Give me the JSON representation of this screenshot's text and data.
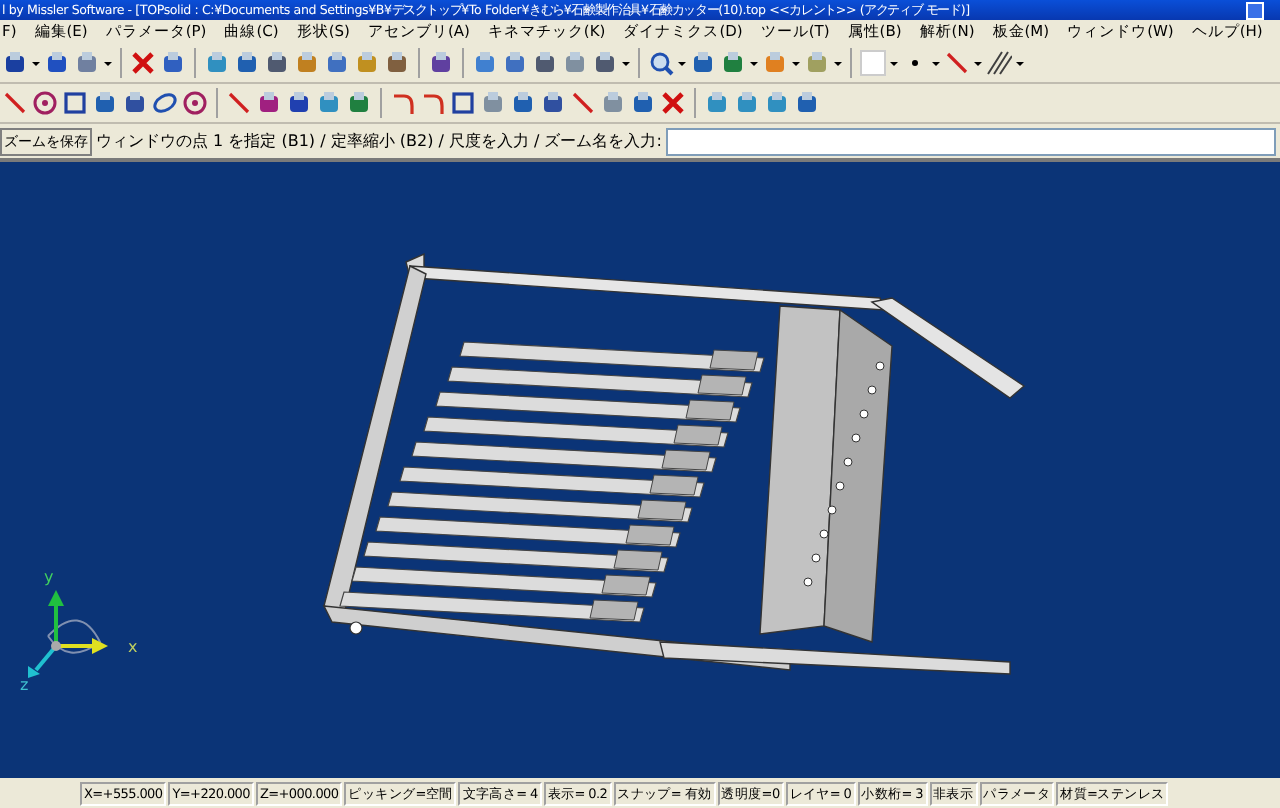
{
  "window": {
    "title": "l by Missler Software - [TOPsolid : C:¥Documents and Settings¥B¥デスクトップ¥To Folder¥きむら¥石鹸製作治具¥石鹸カッター(10).top  <<カレント>> (アクティブ モード)]"
  },
  "menu": [
    "F)",
    "編集(E)",
    "パラメータ(P)",
    "曲線(C)",
    "形状(S)",
    "アセンブリ(A)",
    "キネマチック(K)",
    "ダイナミクス(D)",
    "ツール(T)",
    "属性(B)",
    "解析(N)",
    "板金(M)",
    "ウィンドウ(W)",
    "ヘルプ(H)"
  ],
  "command_line": {
    "button": "ズームを保存",
    "prompt": "ウィンドウの点 1 を指定 (B1) / 定率縮小 (B2) / 尺度を入力 / ズーム名を入力:"
  },
  "viewport": {
    "axis_labels": [
      "y",
      "x",
      "z"
    ]
  },
  "status_bar": [
    "X=+555.000",
    "Y=+220.000",
    "Z=+000.000",
    "ピッキング=空間",
    "文字高さ= 4",
    "表示=  0.2",
    "スナップ= 有効",
    "透明度=0",
    "レイヤ= 0",
    "小数桁= 3",
    "非表示",
    "パラメータ",
    "材質=ステンレス"
  ]
}
